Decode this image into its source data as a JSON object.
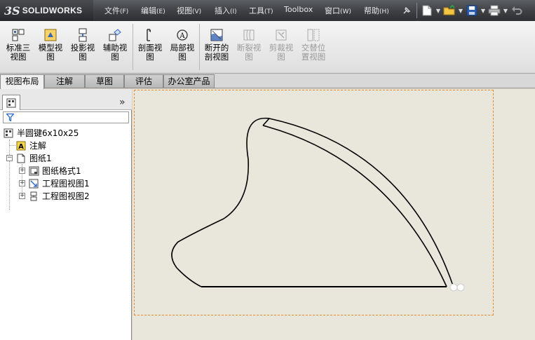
{
  "app": {
    "logo_mark": "3S",
    "logo_text": "SOLIDWORKS"
  },
  "menu": [
    {
      "label": "文件",
      "acc": "(F)"
    },
    {
      "label": "编辑",
      "acc": "(E)"
    },
    {
      "label": "视图",
      "acc": "(V)"
    },
    {
      "label": "插入",
      "acc": "(I)"
    },
    {
      "label": "工具",
      "acc": "(T)"
    },
    {
      "label": "Toolbox",
      "acc": ""
    },
    {
      "label": "窗口",
      "acc": "(W)"
    },
    {
      "label": "帮助",
      "acc": "(H)"
    }
  ],
  "toolbar": {
    "buttons": [
      {
        "label": "标准三\n视图",
        "icon": "standard-3-view-icon",
        "enabled": true
      },
      {
        "label": "模型视\n图",
        "icon": "model-view-icon",
        "enabled": true
      },
      {
        "label": "投影视\n图",
        "icon": "projected-view-icon",
        "enabled": true
      },
      {
        "label": "辅助视\n图",
        "icon": "auxiliary-view-icon",
        "enabled": true
      },
      {
        "label": "剖面视\n图",
        "icon": "section-view-icon",
        "enabled": true
      },
      {
        "label": "局部视\n图",
        "icon": "detail-view-icon",
        "enabled": true
      },
      {
        "label": "断开的\n剖视图",
        "icon": "broken-out-section-icon",
        "enabled": true
      },
      {
        "label": "断裂视\n图",
        "icon": "break-view-icon",
        "enabled": false
      },
      {
        "label": "剪裁视\n图",
        "icon": "crop-view-icon",
        "enabled": false
      },
      {
        "label": "交替位\n置视图",
        "icon": "alternate-position-view-icon",
        "enabled": false
      }
    ]
  },
  "tabs": [
    "视图布局",
    "注解",
    "草图",
    "评估",
    "办公室产品"
  ],
  "active_tab": "视图布局",
  "panel": {
    "expand_symbol": "»",
    "tree": {
      "root": "半圆键6x10x25",
      "annotations": "注解",
      "sheet": "图纸1",
      "sheet_format": "图纸格式1",
      "view1": "工程图视图1",
      "view2": "工程图视图2"
    }
  },
  "colors": {
    "sheet_border": "#f08a24",
    "graphics_bg": "#e9e6db",
    "title_bar": "#3d3f43"
  }
}
